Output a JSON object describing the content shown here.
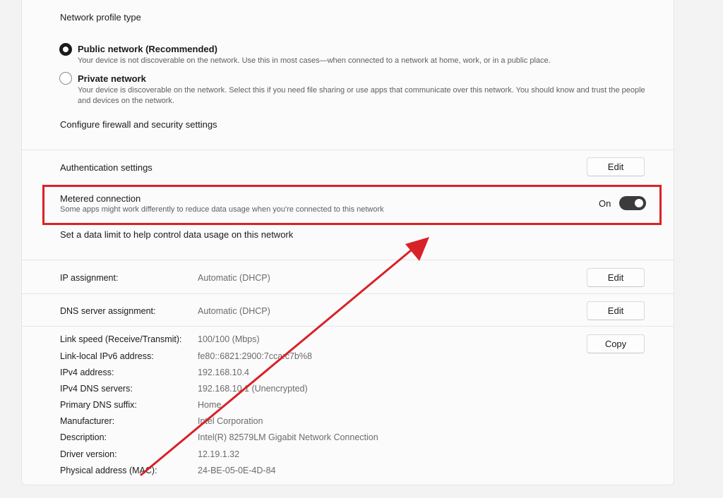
{
  "network_profile": {
    "heading": "Network profile type",
    "public": {
      "label": "Public network (Recommended)",
      "description": "Your device is not discoverable on the network. Use this in most cases—when connected to a network at home, work, or in a public place.",
      "selected": true
    },
    "private": {
      "label": "Private network",
      "description": "Your device is discoverable on the network. Select this if you need file sharing or use apps that communicate over this network. You should know and trust the people and devices on the network.",
      "selected": false
    },
    "firewall_link": "Configure firewall and security settings"
  },
  "authentication": {
    "label": "Authentication settings",
    "button": "Edit"
  },
  "metered": {
    "label": "Metered connection",
    "description": "Some apps might work differently to reduce data usage when you're connected to this network",
    "state_text": "On",
    "enabled": true,
    "data_limit_link": "Set a data limit to help control data usage on this network"
  },
  "ip_assignment": {
    "label": "IP assignment:",
    "value": "Automatic (DHCP)",
    "button": "Edit"
  },
  "dns_assignment": {
    "label": "DNS server assignment:",
    "value": "Automatic (DHCP)",
    "button": "Edit"
  },
  "properties": {
    "copy_button": "Copy",
    "rows": [
      {
        "label": "Link speed (Receive/Transmit):",
        "value": "100/100 (Mbps)"
      },
      {
        "label": "Link-local IPv6 address:",
        "value": "fe80::6821:2900:7cca:c7b%8"
      },
      {
        "label": "IPv4 address:",
        "value": "192.168.10.4"
      },
      {
        "label": "IPv4 DNS servers:",
        "value": "192.168.10.1 (Unencrypted)"
      },
      {
        "label": "Primary DNS suffix:",
        "value": "Home"
      },
      {
        "label": "Manufacturer:",
        "value": "Intel Corporation"
      },
      {
        "label": "Description:",
        "value": "Intel(R) 82579LM Gigabit Network Connection"
      },
      {
        "label": "Driver version:",
        "value": "12.19.1.32"
      },
      {
        "label": "Physical address (MAC):",
        "value": "24-BE-05-0E-4D-84"
      }
    ]
  },
  "annotation": {
    "highlight_color": "#d92128",
    "arrow_color": "#d92128"
  }
}
